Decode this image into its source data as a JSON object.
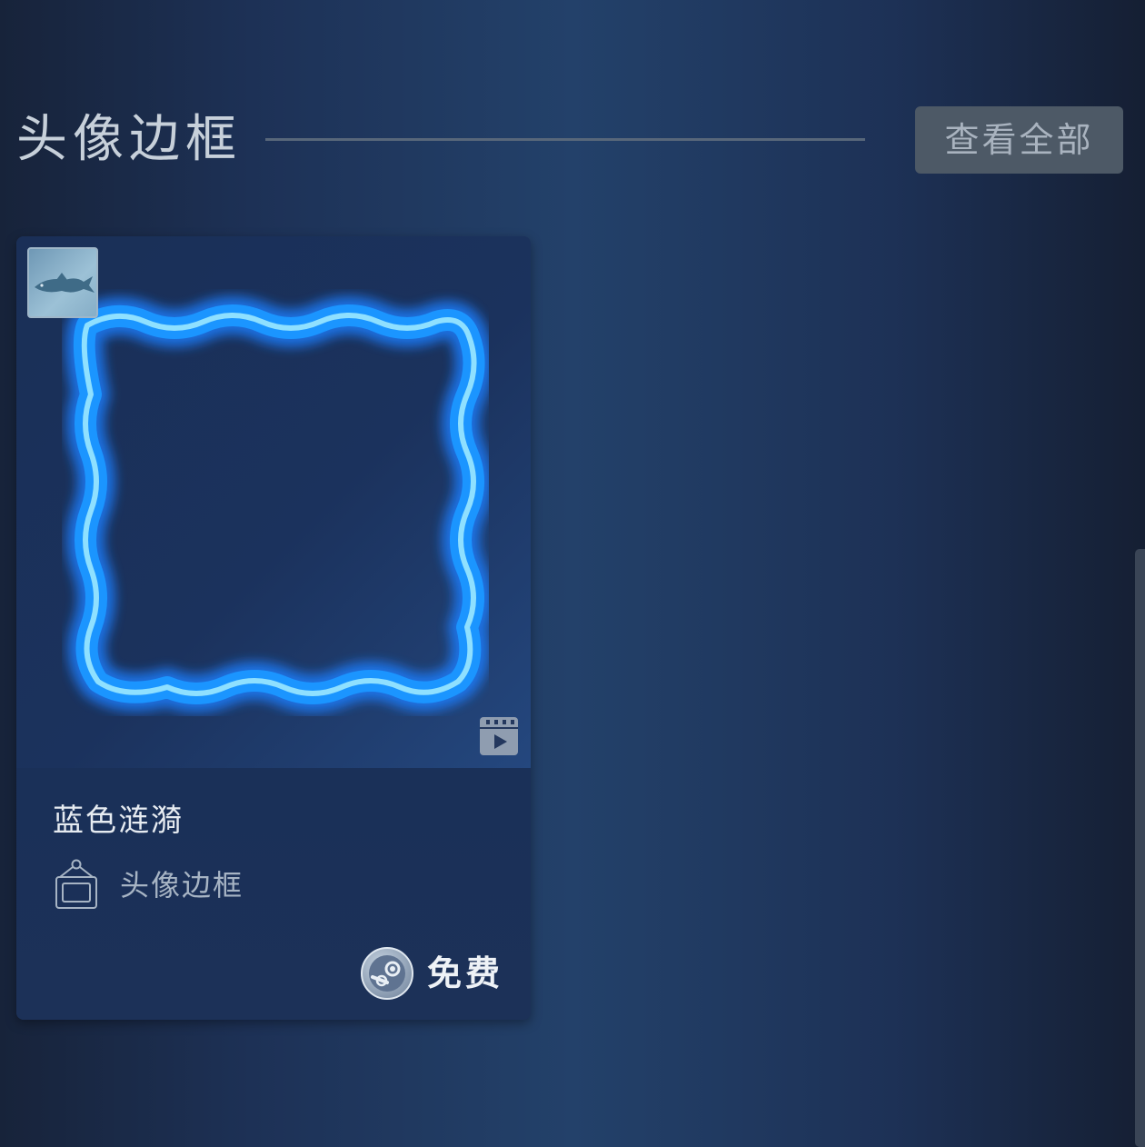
{
  "section": {
    "title": "头像边框",
    "view_all_label": "查看全部"
  },
  "item": {
    "name": "蓝色涟漪",
    "type_label": "头像边框",
    "price_label": "免费",
    "icons": {
      "game_thumbnail": "fish-thumbnail",
      "preview": "video-clapper-icon",
      "type": "avatar-frame-icon",
      "currency": "steam-logo-icon"
    },
    "frame_colors": {
      "glow": "#1f8fff",
      "core": "#7fd8ff"
    }
  }
}
